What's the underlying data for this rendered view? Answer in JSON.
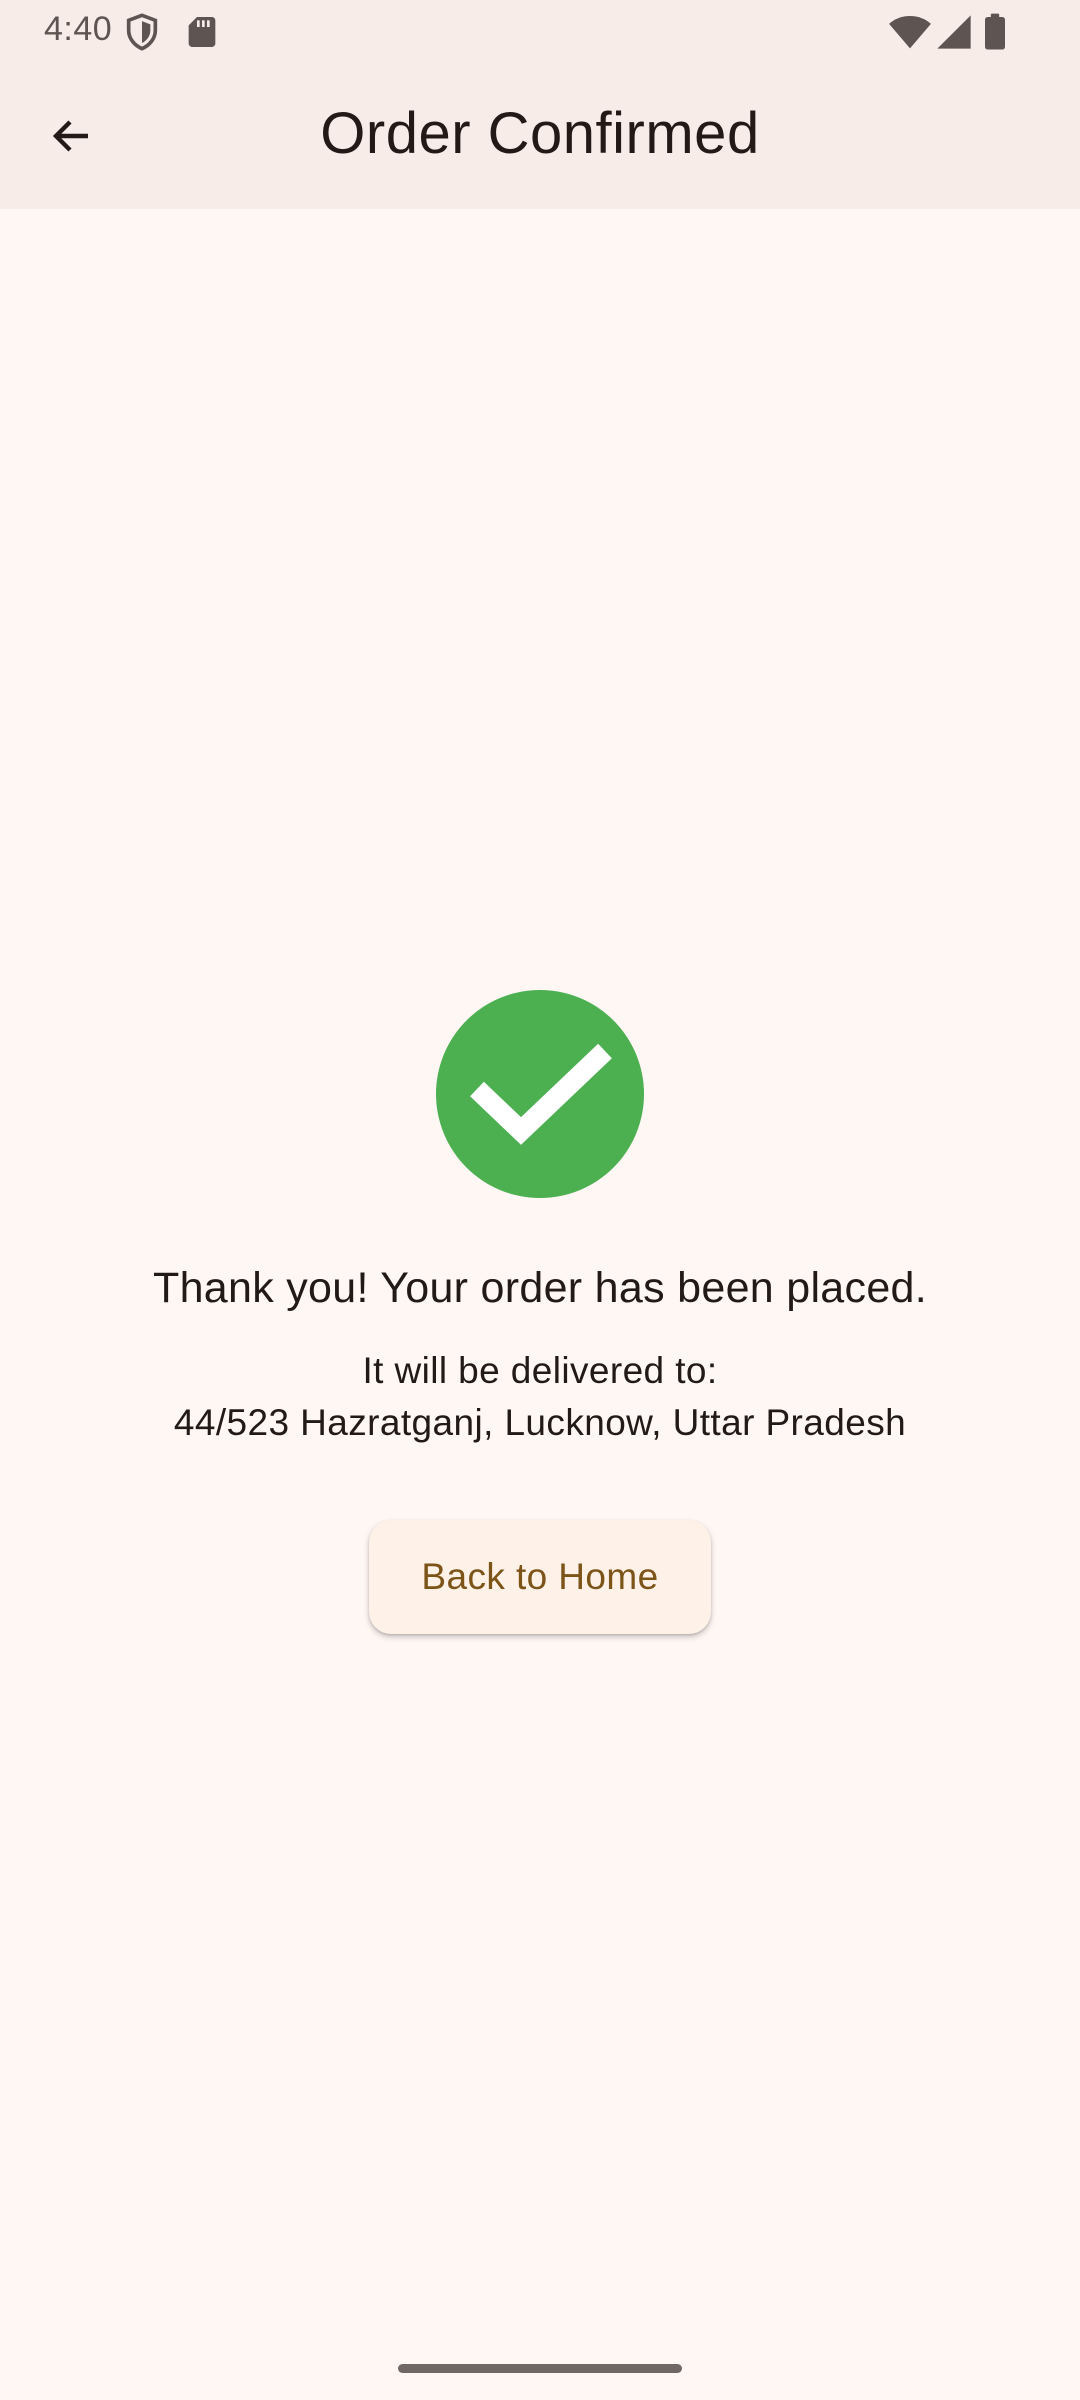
{
  "status_bar": {
    "time": "4:40",
    "icons": [
      "shield-icon",
      "sd-card-icon",
      "wifi-icon",
      "signal-icon",
      "battery-icon"
    ]
  },
  "app_bar": {
    "title": "Order Confirmed",
    "back_icon": "arrow-back-icon"
  },
  "confirmation": {
    "icon": "check-circle-icon",
    "icon_color": "#4caf50",
    "message": "Thank you! Your order has been placed.",
    "delivery_label": "It will be delivered to:",
    "delivery_address": "44/523 Hazratganj, Lucknow, Uttar Pradesh"
  },
  "actions": {
    "home_button_label": "Back to Home"
  },
  "colors": {
    "background": "#fff7f4",
    "app_bar": "#f7ece7",
    "button_text": "#7d5418",
    "button_bg": "#fdf1e8"
  }
}
